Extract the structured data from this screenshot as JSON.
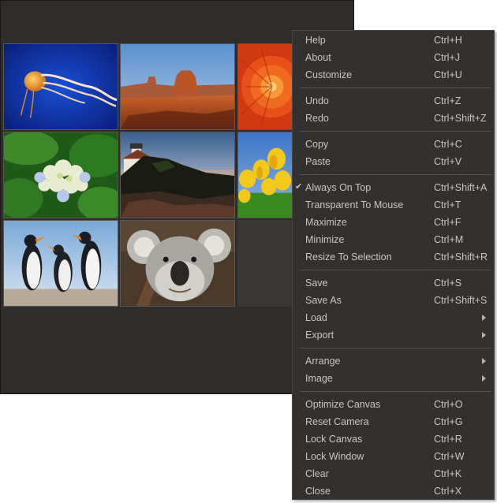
{
  "gallery": {
    "images": [
      {
        "name": "jellyfish-image"
      },
      {
        "name": "desert-mesa-image"
      },
      {
        "name": "chrysanthemum-image"
      },
      {
        "name": "hydrangea-image"
      },
      {
        "name": "lighthouse-image"
      },
      {
        "name": "tulips-image"
      },
      {
        "name": "penguins-image"
      },
      {
        "name": "koala-image"
      }
    ]
  },
  "menu": {
    "items": [
      {
        "label": "Help",
        "shortcut": "Ctrl+H"
      },
      {
        "label": "About",
        "shortcut": "Ctrl+J"
      },
      {
        "label": "Customize",
        "shortcut": "Ctrl+U"
      },
      {
        "label": "Undo",
        "shortcut": "Ctrl+Z"
      },
      {
        "label": "Redo",
        "shortcut": "Ctrl+Shift+Z"
      },
      {
        "label": "Copy",
        "shortcut": "Ctrl+C"
      },
      {
        "label": "Paste",
        "shortcut": "Ctrl+V"
      },
      {
        "label": "Always On Top",
        "shortcut": "Ctrl+Shift+A",
        "checked": true,
        "check_glyph": "✔"
      },
      {
        "label": "Transparent To Mouse",
        "shortcut": "Ctrl+T"
      },
      {
        "label": "Maximize",
        "shortcut": "Ctrl+F"
      },
      {
        "label": "Minimize",
        "shortcut": "Ctrl+M"
      },
      {
        "label": "Resize To Selection",
        "shortcut": "Ctrl+Shift+R"
      },
      {
        "label": "Save",
        "shortcut": "Ctrl+S"
      },
      {
        "label": "Save As",
        "shortcut": "Ctrl+Shift+S"
      },
      {
        "label": "Load",
        "submenu": true
      },
      {
        "label": "Export",
        "submenu": true
      },
      {
        "label": "Arrange",
        "submenu": true
      },
      {
        "label": "Image",
        "submenu": true
      },
      {
        "label": "Optimize Canvas",
        "shortcut": "Ctrl+O"
      },
      {
        "label": "Reset Camera",
        "shortcut": "Ctrl+G"
      },
      {
        "label": "Lock Canvas",
        "shortcut": "Ctrl+R"
      },
      {
        "label": "Lock Window",
        "shortcut": "Ctrl+W"
      },
      {
        "label": "Clear",
        "shortcut": "Ctrl+K"
      },
      {
        "label": "Close",
        "shortcut": "Ctrl+X"
      }
    ]
  },
  "colors": {
    "window_bg": "#2f2d2b",
    "menu_bg": "#33312f",
    "menu_text": "#c9c5c0",
    "separator": "#55524e"
  }
}
